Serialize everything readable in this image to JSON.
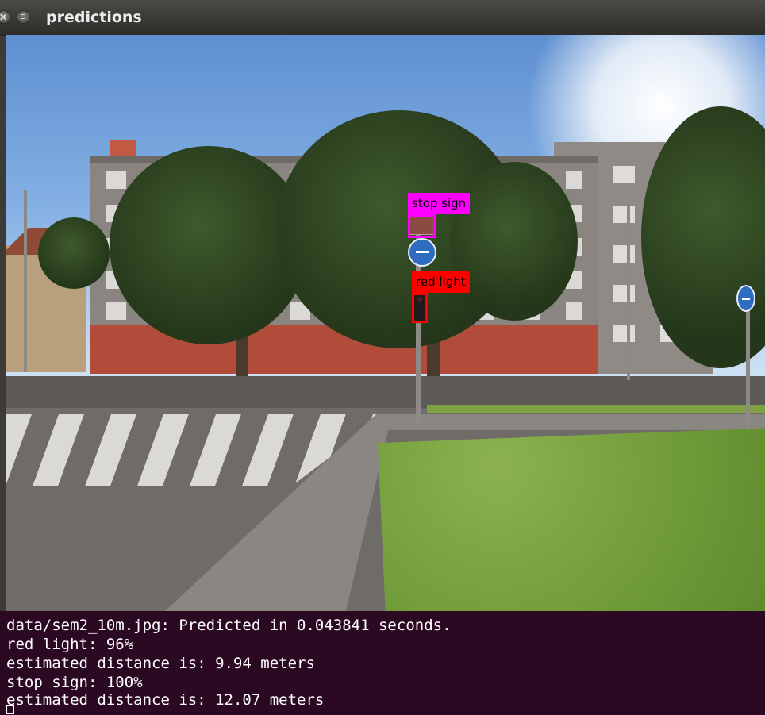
{
  "window": {
    "title": "predictions",
    "buttons": [
      "close-icon",
      "maximize-icon"
    ]
  },
  "detections": [
    {
      "label": "stop sign",
      "color": "#ff00ff"
    },
    {
      "label": "red light",
      "color": "#ff0000"
    }
  ],
  "terminal": {
    "background": "#2b0922",
    "lines": [
      "data/sem2_10m.jpg: Predicted in 0.043841 seconds.",
      "red light: 96%",
      "estimated distance is: 9.94 meters",
      "stop sign: 100%",
      "estimated distance is: 12.07 meters"
    ]
  }
}
